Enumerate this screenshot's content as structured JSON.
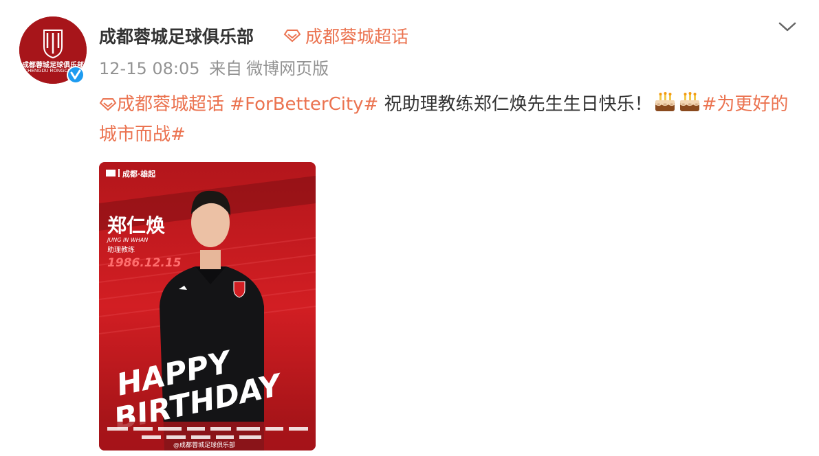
{
  "post": {
    "author": {
      "name": "成都蓉城足球俱乐部",
      "avatar_text": "成都蓉城足球俱乐部",
      "avatar_sub": "CHENGDU RONGCHENG",
      "verified": true
    },
    "super_topic_label": "成都蓉城超话",
    "timestamp": "12-15 08:05",
    "source_prefix": "来自",
    "source_name": "微博网页版",
    "content": {
      "topic_link": "成都蓉城超话",
      "hashtag_1": "#ForBetterCity#",
      "text": "祝助理教练郑仁焕先生生日快乐！",
      "emoji": [
        "cake-icon",
        "cake-icon"
      ],
      "hashtag_2": "#为更好的城市而战#"
    },
    "poster": {
      "brand_header": "成都·雄起",
      "name_cn": "郑仁焕",
      "name_en": "JUNG IN WHAN",
      "role": "助理教练",
      "birthdate": "1986.12.15",
      "happy": "HAPPY",
      "birthday": "BIRTHDAY",
      "watermark": "@成都蓉城足球俱乐部"
    }
  },
  "colors": {
    "link": "#eb7350",
    "meta": "#939393",
    "text": "#333333",
    "brand_red": "#c8191e",
    "verified_blue": "#1d9bf0"
  }
}
